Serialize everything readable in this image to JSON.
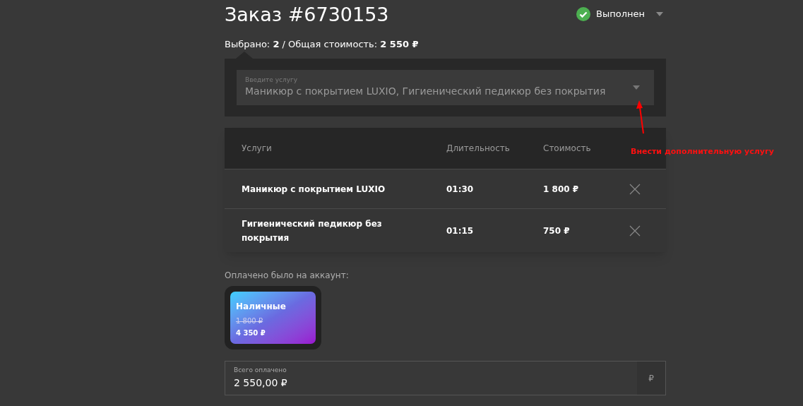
{
  "title": "Заказ #6730153",
  "status": {
    "label": "Выполнен",
    "done": true
  },
  "summary": "Выбрано: **2** / Общая стоимость: **2 550 ₽**",
  "service_field": {
    "label": "Введите услугу",
    "value": "Маникюр с покрытием LUXIO, Гигиенический педикюр без покрытия"
  },
  "table": {
    "columns": [
      "Услуги",
      "Длительность",
      "Стоимость"
    ],
    "rows": [
      {
        "service": "Маникюр с покрытием LUXIO",
        "duration": "01:30",
        "price": "1 800 ₽"
      },
      {
        "service": "Гигиенический педикюр без покрытия",
        "duration": "01:15",
        "price": "750 ₽"
      }
    ]
  },
  "payment": {
    "label": "Оплачено было на аккаунт:",
    "cards": [
      {
        "name": "Наличные",
        "old_amount": "1 800 ₽",
        "amount": "4 350 ₽",
        "selected": true
      }
    ]
  },
  "total_field": {
    "label": "Всего оплачено",
    "value": "2 550,00 ₽",
    "suffix": "₽"
  },
  "annotation": {
    "text": "Внести дополнительную услугу"
  }
}
